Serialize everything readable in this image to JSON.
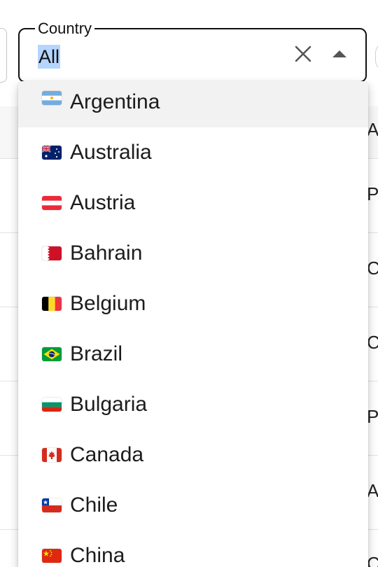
{
  "country_field": {
    "legend": "Country",
    "value": "All",
    "clear_icon": "close-icon",
    "toggle_icon": "caret-up-icon"
  },
  "background_table": {
    "cells": [
      "Ai",
      "Pi",
      "Ci",
      "Ce",
      "Pi",
      "Ae",
      "Ce"
    ]
  },
  "options": [
    {
      "label": "Argentina",
      "flag": "flag-argentina"
    },
    {
      "label": "Australia",
      "flag": "flag-australia"
    },
    {
      "label": "Austria",
      "flag": "flag-austria"
    },
    {
      "label": "Bahrain",
      "flag": "flag-bahrain"
    },
    {
      "label": "Belgium",
      "flag": "flag-belgium"
    },
    {
      "label": "Brazil",
      "flag": "flag-brazil"
    },
    {
      "label": "Bulgaria",
      "flag": "flag-bulgaria"
    },
    {
      "label": "Canada",
      "flag": "flag-canada"
    },
    {
      "label": "Chile",
      "flag": "flag-chile"
    },
    {
      "label": "China",
      "flag": "flag-china"
    }
  ],
  "colors": {
    "selection_highlight": "#b4d5fe",
    "option_hover": "#f2f2f2",
    "field_border": "#111111"
  }
}
